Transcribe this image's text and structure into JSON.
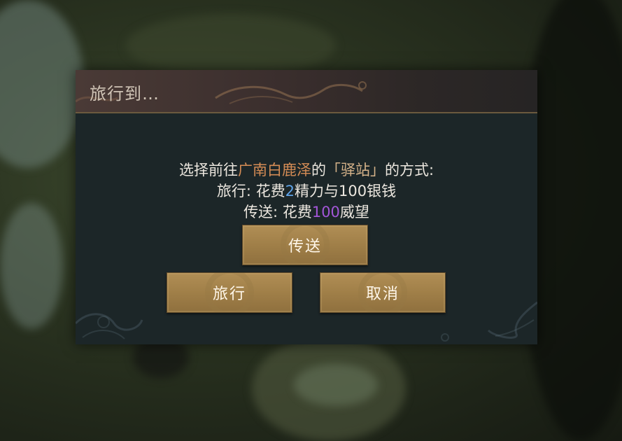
{
  "dialog": {
    "title": "旅行到…",
    "line1": {
      "prefix": "选择前往",
      "place": "广南白鹿泽",
      "mid": "的",
      "quoted": "「驿站」",
      "suffix": "的方式:"
    },
    "line2": {
      "prefix": "旅行: 花费",
      "energy": "2",
      "suffix": "精力与100银钱"
    },
    "line3": {
      "prefix": "传送: 花费",
      "prestige": "100",
      "suffix": "威望"
    },
    "buttons": {
      "teleport": "传送",
      "travel": "旅行",
      "cancel": "取消"
    }
  },
  "colors": {
    "place_highlight": "#d58c55",
    "energy_highlight": "#5fa3e8",
    "prestige_highlight": "#a356d8",
    "button_fill": "#a07f48"
  }
}
